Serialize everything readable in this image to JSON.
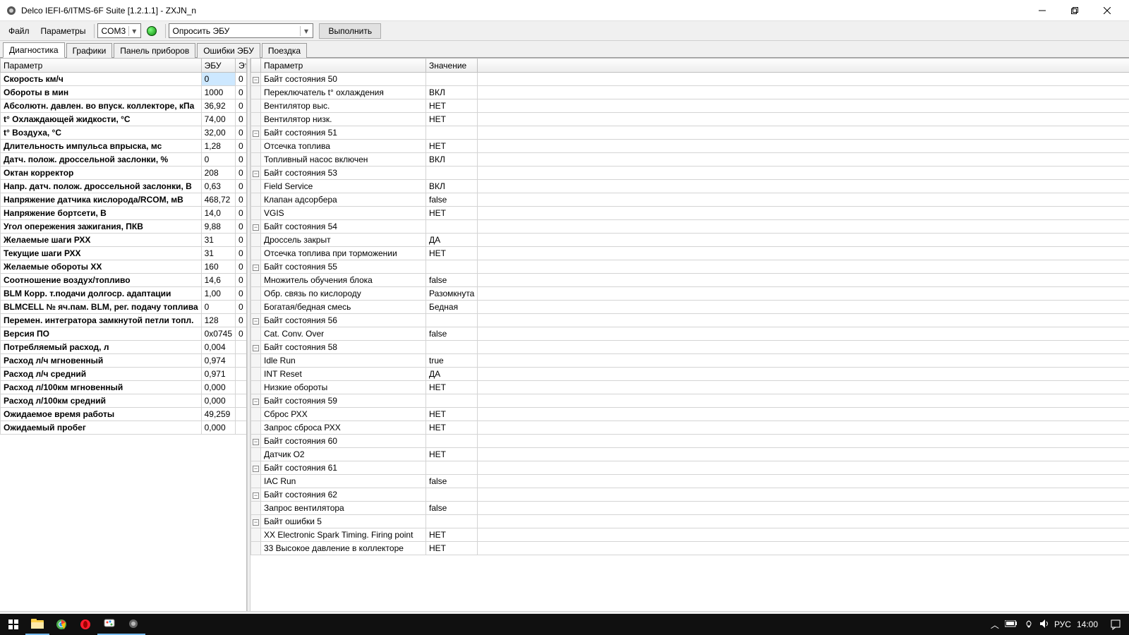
{
  "window": {
    "title": "Delco IEFI-6/ITMS-6F Suite [1.2.1.1] - ZXJN_n"
  },
  "menu": {
    "file": "Файл",
    "params": "Параметры"
  },
  "toolbar": {
    "port": "COM3",
    "action": "Опросить ЭБУ",
    "run": "Выполнить"
  },
  "tabs": {
    "diag": "Диагностика",
    "charts": "Графики",
    "dash": "Панель приборов",
    "errors": "Ошибки ЭБУ",
    "trip": "Поездка"
  },
  "left": {
    "headers": {
      "param": "Параметр",
      "ecu": "ЭБУ",
      "ref": "Эталон"
    },
    "rows": [
      {
        "p": "Скорость км/ч",
        "e": "0",
        "r": "0",
        "sel": true
      },
      {
        "p": "Обороты в мин",
        "e": "1000",
        "r": "0"
      },
      {
        "p": "Абсолютн. давлен. во впуск. коллекторе, кПа",
        "e": "36,92",
        "r": "0"
      },
      {
        "p": "t° Охлаждающей жидкости, °С",
        "e": "74,00",
        "r": "0"
      },
      {
        "p": "t° Воздуха, °С",
        "e": "32,00",
        "r": "0"
      },
      {
        "p": "Длительность импульса впрыска, мс",
        "e": "1,28",
        "r": "0"
      },
      {
        "p": "Датч. полож. дроссельной заслонки, %",
        "e": "0",
        "r": "0"
      },
      {
        "p": "Октан корректор",
        "e": "208",
        "r": "0"
      },
      {
        "p": "Напр. датч. полож. дроссельной заслонки, В",
        "e": "0,63",
        "r": "0"
      },
      {
        "p": "Напряжение датчика кислорода/RCOM, мВ",
        "e": "468,72",
        "r": "0"
      },
      {
        "p": "Напряжение бортсети, В",
        "e": "14,0",
        "r": "0"
      },
      {
        "p": "Угол опережения зажигания, ПКВ",
        "e": "9,88",
        "r": "0"
      },
      {
        "p": "Желаемые шаги РХХ",
        "e": "31",
        "r": "0"
      },
      {
        "p": "Текущие шаги РХХ",
        "e": "31",
        "r": "0"
      },
      {
        "p": "Желаемые обороты ХХ",
        "e": "160",
        "r": "0"
      },
      {
        "p": "Соотношение воздух/топливо",
        "e": "14,6",
        "r": "0"
      },
      {
        "p": "BLM Корр. т.подачи долгоср. адаптации",
        "e": "1,00",
        "r": "0"
      },
      {
        "p": "BLMCELL № яч.пам. BLM, рег. подачу топлива",
        "e": "0",
        "r": "0"
      },
      {
        "p": "Перемен. интегратора замкнутой петли топл.",
        "e": "128",
        "r": "0"
      },
      {
        "p": "Версия ПО",
        "e": "0x0745",
        "r": "0"
      },
      {
        "p": "Потребляемый расход, л",
        "e": "0,004",
        "r": ""
      },
      {
        "p": "Расход л/ч мгновенный",
        "e": "0,974",
        "r": ""
      },
      {
        "p": "Расход л/ч средний",
        "e": "0,971",
        "r": ""
      },
      {
        "p": "Расход л/100км мгновенный",
        "e": "0,000",
        "r": ""
      },
      {
        "p": "Расход л/100км средний",
        "e": "0,000",
        "r": ""
      },
      {
        "p": "Ожидаемое время работы",
        "e": "49,259",
        "r": ""
      },
      {
        "p": "Ожидаемый пробег",
        "e": "0,000",
        "r": ""
      }
    ]
  },
  "right": {
    "headers": {
      "param": "Параметр",
      "val": "Значение"
    },
    "rows": [
      {
        "g": true,
        "p": "Байт состояния 50",
        "v": ""
      },
      {
        "p": "Переключатель t° охлаждения",
        "v": "ВКЛ"
      },
      {
        "p": "Вентилятор выс.",
        "v": "НЕТ"
      },
      {
        "p": "Вентилятор низк.",
        "v": "НЕТ"
      },
      {
        "g": true,
        "p": "Байт состояния 51",
        "v": ""
      },
      {
        "p": "Отсечка топлива",
        "v": "НЕТ"
      },
      {
        "p": "Топливный насос включен",
        "v": "ВКЛ"
      },
      {
        "g": true,
        "p": "Байт состояния 53",
        "v": ""
      },
      {
        "p": "Field Service",
        "v": "ВКЛ"
      },
      {
        "p": "Клапан адсорбера",
        "v": "false"
      },
      {
        "p": "VGIS",
        "v": "НЕТ"
      },
      {
        "g": true,
        "p": "Байт состояния 54",
        "v": ""
      },
      {
        "p": "Дроссель закрыт",
        "v": "ДА"
      },
      {
        "p": "Отсечка топлива при торможении",
        "v": "НЕТ"
      },
      {
        "g": true,
        "p": "Байт состояния 55",
        "v": ""
      },
      {
        "p": "Множитель обучения блока",
        "v": "false"
      },
      {
        "p": "Обр. связь по кислороду",
        "v": "Разомкнута"
      },
      {
        "p": "Богатая/бедная смесь",
        "v": "Бедная"
      },
      {
        "g": true,
        "p": "Байт состояния 56",
        "v": ""
      },
      {
        "p": "Cat. Conv. Over",
        "v": "false"
      },
      {
        "g": true,
        "p": "Байт состояния 58",
        "v": ""
      },
      {
        "p": "Idle Run",
        "v": "true"
      },
      {
        "p": "INT Reset",
        "v": "ДА"
      },
      {
        "p": "Низкие обороты",
        "v": "НЕТ"
      },
      {
        "g": true,
        "p": "Байт состояния 59",
        "v": ""
      },
      {
        "p": "Сброс РХХ",
        "v": "НЕТ"
      },
      {
        "p": "Запрос сброса РХХ",
        "v": "НЕТ"
      },
      {
        "g": true,
        "p": "Байт состояния 60",
        "v": ""
      },
      {
        "p": "Датчик O2",
        "v": "НЕТ"
      },
      {
        "g": true,
        "p": "Байт состояния 61",
        "v": ""
      },
      {
        "p": "IAC Run",
        "v": "false"
      },
      {
        "g": true,
        "p": "Байт состояния 62",
        "v": ""
      },
      {
        "p": "Запрос вентилятора",
        "v": "false"
      },
      {
        "g": true,
        "p": "Байт ошибки 5",
        "v": ""
      },
      {
        "p": "XX Electronic Spark Timing. Firing point",
        "v": "НЕТ"
      },
      {
        "p": "33 Высокое давление в коллекторе",
        "v": "НЕТ"
      }
    ]
  },
  "taskbar": {
    "lang": "РУС",
    "time": "14:00"
  }
}
